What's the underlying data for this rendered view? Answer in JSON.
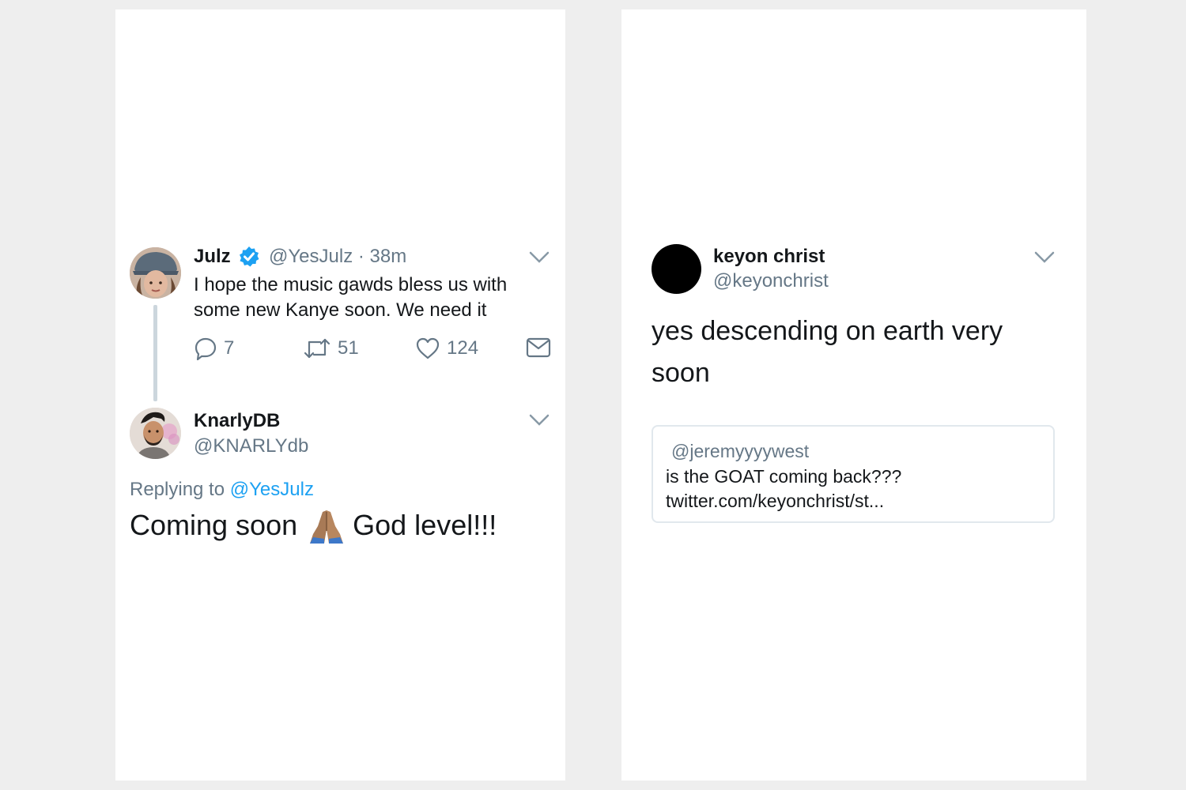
{
  "left_panel": {
    "tweet": {
      "name": "Julz",
      "handle": "@YesJulz",
      "separator": "·",
      "time": "38m",
      "text": "I hope the music gawds bless us with some new Kanye soon. We need it",
      "actions": {
        "reply_count": "7",
        "retweet_count": "51",
        "like_count": "124"
      },
      "icons": [
        "verified-badge-icon",
        "reply-icon",
        "retweet-icon",
        "heart-icon",
        "mail-icon",
        "chevron-down-icon"
      ]
    },
    "reply": {
      "name": "KnarlyDB",
      "handle": "@KNARLYdb",
      "replying_prefix": "Replying to",
      "replying_mention": "@YesJulz",
      "text_before": "Coming soon",
      "emoji": "folded-hands-emoji",
      "text_after": "God level!!!"
    }
  },
  "right_panel": {
    "tweet": {
      "name": "keyon christ",
      "handle": "@keyonchrist",
      "text": "yes descending on earth very soon",
      "quote": {
        "handle": "@jeremyyyywest",
        "line1": "is the GOAT coming back???",
        "line2": "twitter.com/keyonchrist/st..."
      }
    }
  },
  "colors": {
    "background": "#eeeeee",
    "card": "#ffffff",
    "text": "#14171a",
    "secondary": "#657786",
    "link": "#1da1f2",
    "thread_line": "#ccd6dd"
  }
}
